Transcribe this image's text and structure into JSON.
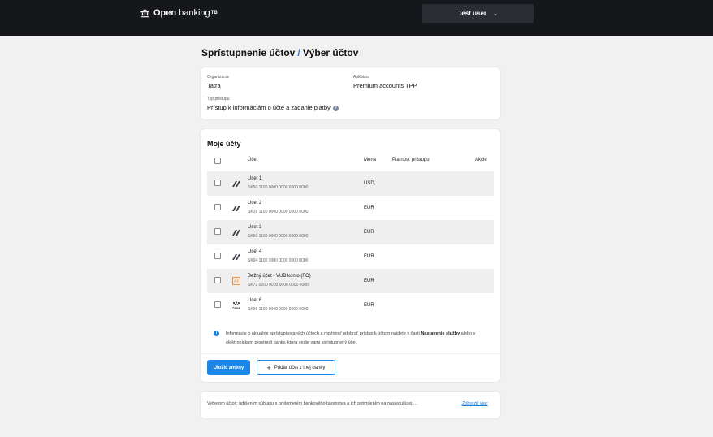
{
  "header": {
    "brand_bold": "Open",
    "brand_light": "banking",
    "brand_sup": "TB",
    "user_label": "Test user"
  },
  "page": {
    "title_part1": "Sprístupnenie účtov",
    "separator": "/",
    "title_part2": "Výber účtov"
  },
  "info": {
    "org_label": "Organizácia",
    "org_value": "Tatra",
    "app_label": "Aplikácia",
    "app_value": "Premium accounts TPP",
    "access_label": "Typ prístupu",
    "access_value": "Prístup k informáciám o účte a zadanie platby"
  },
  "accounts": {
    "section_title": "Moje účty",
    "columns": {
      "account": "Účet",
      "currency": "Mena",
      "validity": "Platnosť prístupu",
      "actions": "Akcie"
    },
    "rows": [
      {
        "name": "Ucet 1",
        "iban": "SK50 1100 0000 0000 0000 0000",
        "currency": "USD",
        "icon": "tatra-bank-icon"
      },
      {
        "name": "Ucet 2",
        "iban": "SK18 1100 0000 0000 0000 0000",
        "currency": "EUR",
        "icon": "tatra-bank-icon"
      },
      {
        "name": "Ucet 3",
        "iban": "SK60 1100 0000 0000 0000 0000",
        "currency": "EUR",
        "icon": "tatra-bank-icon"
      },
      {
        "name": "Ucet 4",
        "iban": "SK94 1100 0000 0000 0000 0000",
        "currency": "EUR",
        "icon": "tatra-bank-icon"
      },
      {
        "name": "Bežný účet - VUB konto (FO)",
        "iban": "SK72 0200 0000 0000 0000 0000",
        "currency": "EUR",
        "icon": "vub-bank-icon"
      },
      {
        "name": "Ucet 6",
        "iban": "SK98 1100 0000 0000 0000 0000",
        "currency": "EUR",
        "icon": "csob-bank-icon"
      }
    ],
    "note_pre": "Informácie o aktuálne sprístupňovaných účtoch a možnosť odobrať prístup k účtom nájdete v časti ",
    "note_bold": "Nastavenie služby",
    "note_post": " alebo v elektronickom prostredí banky, ktorá vedie vami sprístupnený účet.",
    "save_label": "Uložiť zmeny",
    "add_label": "Pridať účet z inej banky",
    "csob_label": "ČSOB"
  },
  "consent": {
    "text": "Vyberom účtov, udelením súhlasu s prelomením bankového tajomstva a ich potvrdením na nasledujúcej ...",
    "link": "Zobraziť viac"
  },
  "colors": {
    "topbar": "#15171b",
    "accent": "#1a86e8",
    "background": "#f1f1f1"
  }
}
